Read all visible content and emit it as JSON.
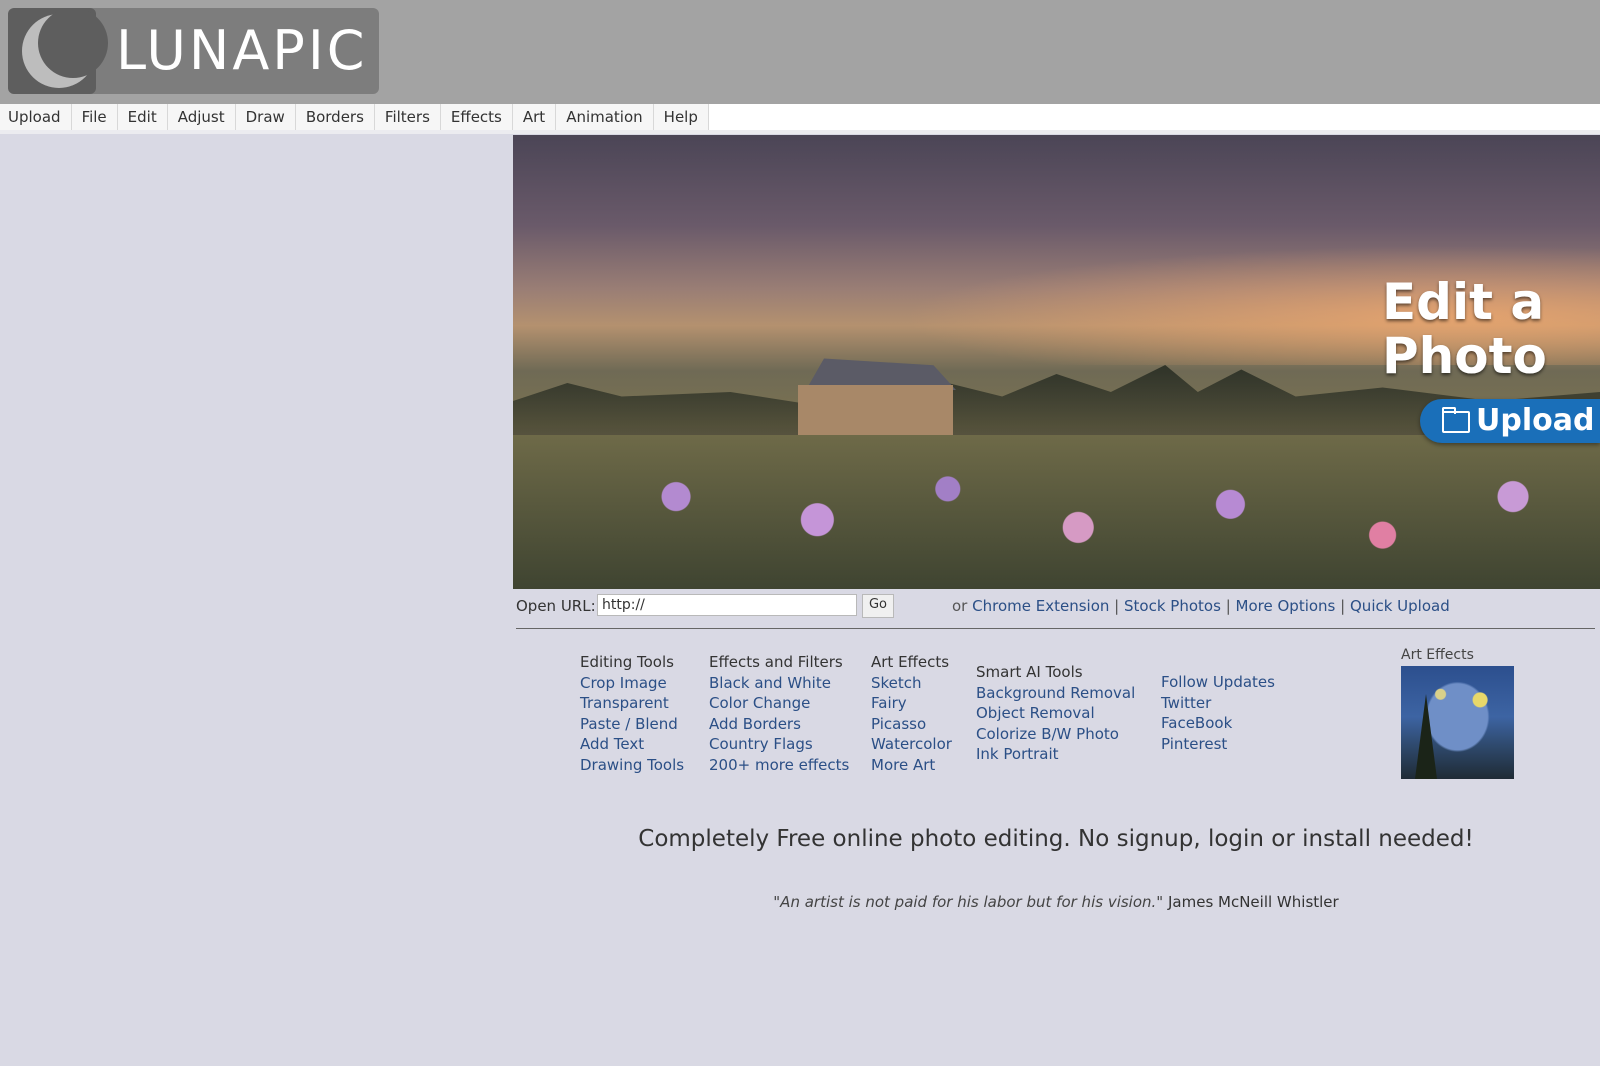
{
  "logo": {
    "text": "LUNAPIC"
  },
  "menu": [
    "Upload",
    "File",
    "Edit",
    "Adjust",
    "Draw",
    "Borders",
    "Filters",
    "Effects",
    "Art",
    "Animation",
    "Help"
  ],
  "hero": {
    "title_line1": "Edit a",
    "title_line2": "Photo",
    "upload_label": "Upload",
    "upload_icon": "folder-icon"
  },
  "url_bar": {
    "label": "Open URL:",
    "value": "http://",
    "go_label": "Go",
    "or_text": "or",
    "links": [
      "Chrome Extension",
      "Stock Photos",
      "More Options",
      "Quick Upload"
    ],
    "separator": "|"
  },
  "columns": [
    {
      "heading": "Editing Tools",
      "links": [
        "Crop Image",
        "Transparent",
        "Paste / Blend",
        "Add Text",
        "Drawing Tools"
      ]
    },
    {
      "heading": "Effects and Filters",
      "links": [
        "Black and White",
        "Color Change",
        "Add Borders",
        "Country Flags",
        "200+ more effects"
      ]
    },
    {
      "heading": "Art Effects",
      "links": [
        "Sketch",
        "Fairy",
        "Picasso",
        "Watercolor",
        "More Art"
      ]
    },
    {
      "heading": "Smart AI Tools",
      "links": [
        "Background Removal",
        "Object Removal",
        "Colorize B/W Photo",
        "Ink Portrait"
      ]
    },
    {
      "heading": "",
      "links": [
        "Follow Updates",
        "Twitter",
        "FaceBook",
        "Pinterest"
      ]
    }
  ],
  "art_effects": {
    "title": "Art Effects"
  },
  "tagline": "Completely Free online photo editing. No signup, login or install needed!",
  "quote": {
    "text": "\"An artist is not paid for his labor but for his vision.\"",
    "author": "James McNeill Whistler"
  },
  "colors": {
    "topbar": "#a3a3a3",
    "page_bg": "#d9d9e4",
    "link": "#2b4f86",
    "upload_button": "#1a6fb9"
  }
}
